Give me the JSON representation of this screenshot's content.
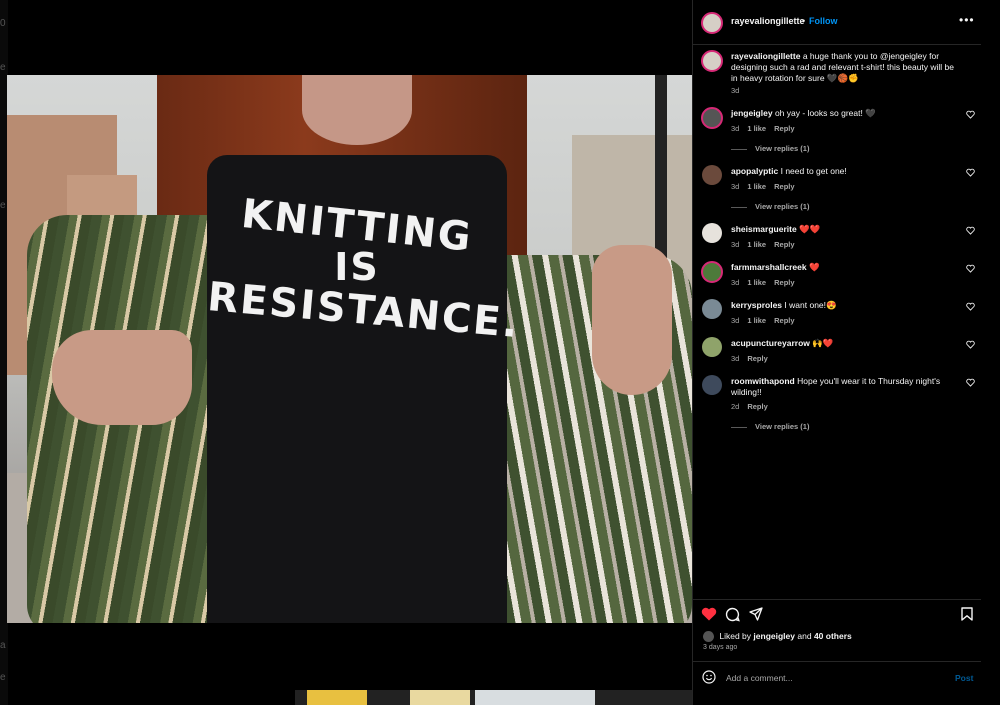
{
  "post": {
    "username": "rayevaliongillette",
    "separator": "•",
    "follow_label": "Follow",
    "more_label": "•••",
    "caption": {
      "username": "rayevaliongillette",
      "text": "a huge thank you to @jengeigley for designing such a rad and relevant t-shirt! this beauty will be in heavy rotation for sure 🖤🏀✊",
      "age": "3d"
    },
    "shirt_lines": [
      "KNITTING",
      "IS",
      "RESISTANCE."
    ]
  },
  "comments": [
    {
      "username": "jengeigley",
      "text": "oh yay - looks so great! 🖤",
      "age": "3d",
      "likes": "1 like",
      "reply": "Reply",
      "view_replies": "View replies (1)"
    },
    {
      "username": "apopalyptic",
      "text": "I need to get one!",
      "age": "3d",
      "likes": "1 like",
      "reply": "Reply",
      "view_replies": "View replies (1)"
    },
    {
      "username": "sheismarguerite",
      "text": "❤️❤️",
      "age": "3d",
      "likes": "1 like",
      "reply": "Reply"
    },
    {
      "username": "farmmarshallcreek",
      "text": "❤️",
      "age": "3d",
      "likes": "1 like",
      "reply": "Reply"
    },
    {
      "username": "kerrysproles",
      "text": "I want one!😍",
      "age": "3d",
      "likes": "1 like",
      "reply": "Reply"
    },
    {
      "username": "acupunctureyarrow",
      "text": "🙌❤️",
      "age": "3d",
      "reply": "Reply"
    },
    {
      "username": "roomwithapond",
      "text": "Hope you'll wear it to Thursday night's wilding!!",
      "age": "2d",
      "reply": "Reply",
      "view_replies": "View replies (1)"
    }
  ],
  "likes": {
    "prefix": "Liked by",
    "user": "jengeigley",
    "and": "and",
    "others": "40 others"
  },
  "posted": "3 days ago",
  "add_comment": {
    "placeholder": "Add a comment...",
    "post_label": "Post"
  },
  "background_edge_text": [
    "0",
    "e",
    "e",
    "a",
    "e"
  ],
  "colors": {
    "accent": "#0095f6",
    "like_red": "#ff3040",
    "ring": "#d62976"
  }
}
